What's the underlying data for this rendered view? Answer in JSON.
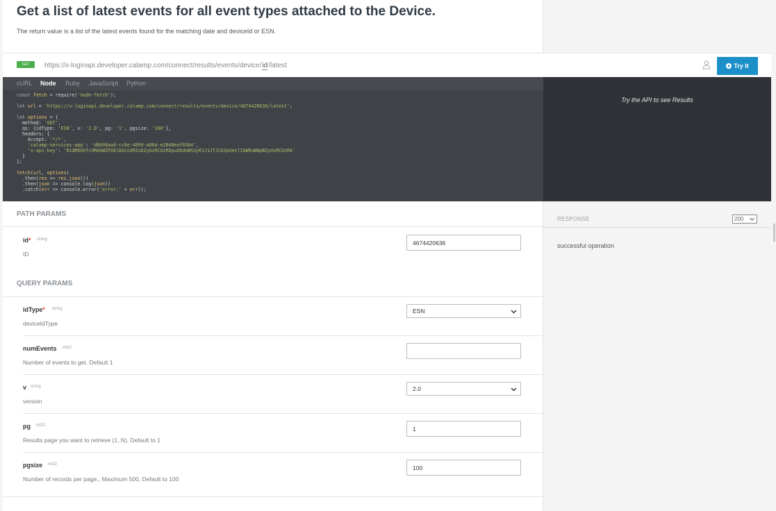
{
  "header": {
    "title": "Get a list of latest events for all event types attached to the Device.",
    "description": "The return value is a list of the latest events found for the matching date and deviceId or ESN."
  },
  "endpoint": {
    "method": "GET",
    "url_prefix": "https://x-loginapi.developer.calamp.com/connect/results/events/device/",
    "url_param": "id",
    "url_suffix": "/latest",
    "try_label": "Try It"
  },
  "code_tabs": {
    "items": [
      "cURL",
      "Node",
      "Ruby",
      "JavaScript",
      "Python"
    ],
    "active": "Node"
  },
  "code": {
    "language": "Node",
    "lines": [
      "const fetch = require('node-fetch');",
      "",
      "let url = 'https://x-loginapi.developer.calamp.com/connect/results/events/device/4674420636/latest';",
      "",
      "let options = {",
      "  method: 'GET',",
      "  qs: {idType: 'ESN', v: '2.0', pg: '1', pgsize: '100'},",
      "  headers: {",
      "    Accept: '*/*',",
      "    'calamp-services-app': 'd8b98aad-cc6e-4899-a86d-e2848eaf03b4',",
      "    'x-api-key': 'R1dMOGhTcVM4UWZFOElDbCo3R2xDZyUzRCUzRDpudOdnWSUyR1J1JTJCU3pUenlIUWRuWWpBZyUzRCUzRA'",
      "  }",
      "};",
      "",
      "fetch(url, options)",
      "  .then(res => res.json())",
      "  .then(json => console.log(json))",
      "  .catch(err => console.error('error:' + err));"
    ]
  },
  "results": {
    "message": "Try the API to see Results"
  },
  "path_params": {
    "section_title": "PATH PARAMS",
    "items": [
      {
        "name": "id",
        "required_mark": "*",
        "type": "string",
        "description": "ID",
        "value": "4674420636"
      }
    ]
  },
  "query_params": {
    "section_title": "QUERY PARAMS",
    "items": [
      {
        "name": "idType",
        "required_mark": "*",
        "type": "string",
        "description": "deviceIdType",
        "value": "ESN"
      },
      {
        "name": "numEvents",
        "type": "int32",
        "description": "Number of events to get. Default 1",
        "value": ""
      },
      {
        "name": "v",
        "type": "string",
        "description": "version",
        "value": "2.0"
      },
      {
        "name": "pg",
        "type": "int32",
        "description": "Results page you want to retrieve (1..N), Default to 1",
        "value": "1"
      },
      {
        "name": "pgsize",
        "type": "int32",
        "description": "Number of records per page., Maximum 500, Default to 100",
        "value": "100"
      }
    ]
  },
  "response": {
    "label": "RESPONSE",
    "status_code": "200",
    "description": "successful operation"
  },
  "colors": {
    "accent": "#1b8fc8",
    "method_get": "#4cae4c",
    "code_bg": "#3f4348",
    "results_bg": "#2f3337",
    "required": "#e03b3b"
  }
}
